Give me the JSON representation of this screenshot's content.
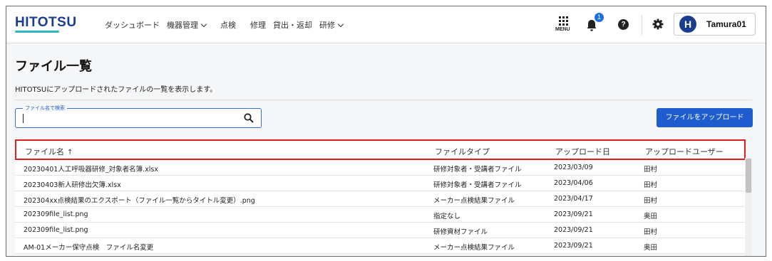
{
  "header": {
    "logo": "HITOTSU",
    "nav": [
      {
        "label": "ダッシュボード",
        "has_dropdown": false
      },
      {
        "label": "機器管理",
        "has_dropdown": true
      },
      {
        "label": "点検",
        "has_dropdown": false
      },
      {
        "label": "修理",
        "has_dropdown": false
      },
      {
        "label": "貸出・返却",
        "has_dropdown": false
      },
      {
        "label": "研修",
        "has_dropdown": true
      }
    ],
    "menu_label": "MENU",
    "notification_count": "1",
    "help_glyph": "?",
    "avatar_initial": "H",
    "user_name": "Tamura01"
  },
  "page": {
    "title": "ファイル一覧",
    "description": "HITOTSUにアップロードされたファイルの一覧を表示します。"
  },
  "search": {
    "label": "ファイル名で検索",
    "value": ""
  },
  "upload_button": "ファイルをアップロード",
  "table": {
    "columns": [
      "ファイル名",
      "ファイルタイプ",
      "アップロード日",
      "アップロードユーザー"
    ],
    "sort_indicator": "↑",
    "rows": [
      [
        "20230401人工呼吸器研修_対象者名簿.xlsx",
        "研修対象者・受講者ファイル",
        "2023/03/09",
        "田村"
      ],
      [
        "20230403新人研修出欠簿.xlsx",
        "研修対象者・受講者ファイル",
        "2023/04/06",
        "田村"
      ],
      [
        "202304xx点検結果のエクスポート（ファイル一覧からタイトル変更）.png",
        "メーカー点検結果ファイル",
        "2023/04/17",
        "田村"
      ],
      [
        "202309file_list.png",
        "指定なし",
        "2023/09/21",
        "奥田"
      ],
      [
        "202309file_list.png",
        "研修資材ファイル",
        "2023/09/21",
        "田村"
      ],
      [
        "AM-01メーカー保守点検　ファイル名変更",
        "メーカー点検結果ファイル",
        "2023/09/21",
        "奥田"
      ]
    ]
  },
  "colors": {
    "brand": "#1a3d8f",
    "accent": "#1f5dce",
    "highlight_border": "#e02020"
  }
}
